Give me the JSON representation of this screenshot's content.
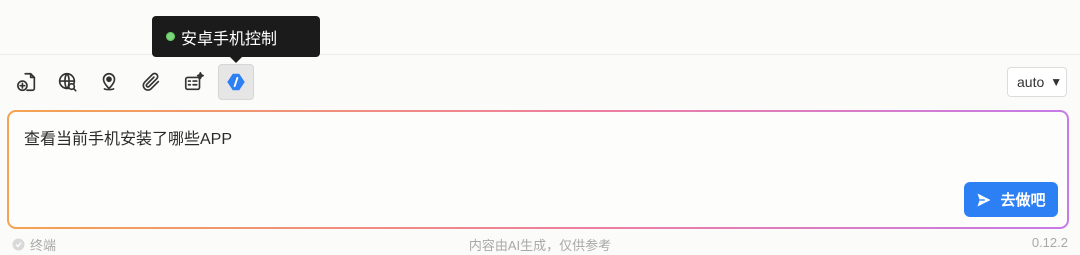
{
  "tooltip": {
    "text": "安卓手机控制",
    "status_color": "#7ed67a"
  },
  "toolbar": {
    "icons": [
      "file-add-icon",
      "globe-search-icon",
      "location-pin-icon",
      "paperclip-icon",
      "media-sparkle-icon",
      "android-control-icon"
    ],
    "active_tool": "android-control-icon",
    "model_select": "auto"
  },
  "input": {
    "value": "查看当前手机安装了哪些APP"
  },
  "send_button": {
    "label": "去做吧",
    "color": "#2c80f4"
  },
  "footer": {
    "mode_label": "终端",
    "disclaimer": "内容由AI生成，仅供参考",
    "version": "0.12.2"
  }
}
